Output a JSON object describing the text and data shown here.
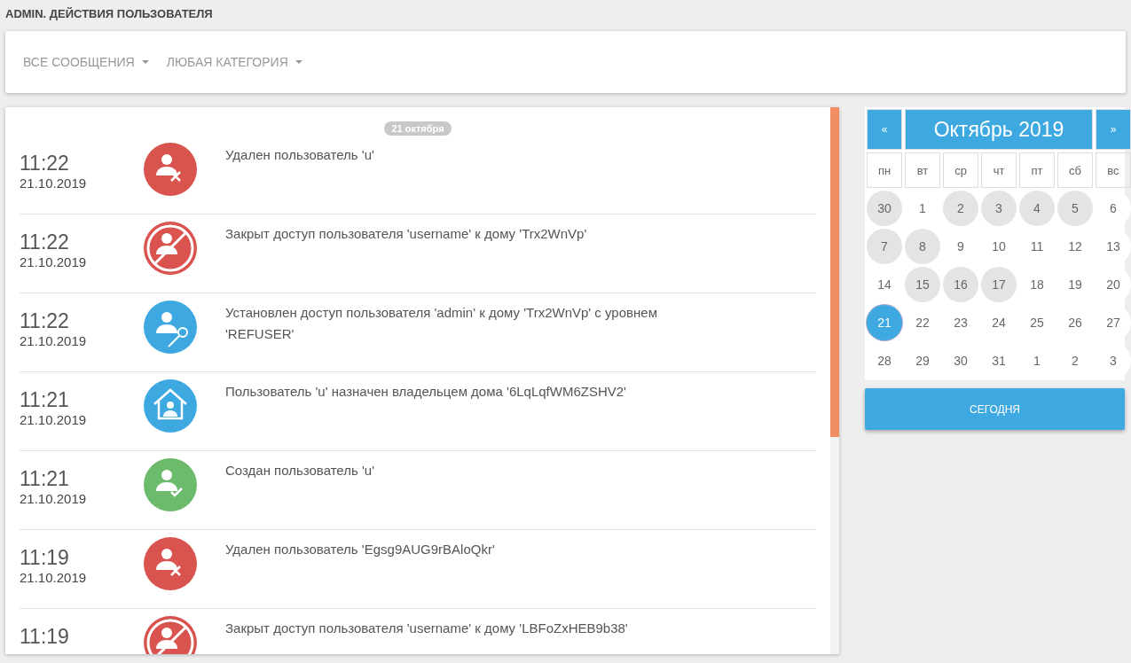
{
  "page_title": "ADMIN. ДЕЙСТВИЯ ПОЛЬЗОВАТЕЛЯ",
  "filters": [
    {
      "label": "ВСЕ СООБЩЕНИЯ"
    },
    {
      "label": "ЛЮБАЯ КАТЕГОРИЯ"
    }
  ],
  "feed": {
    "date_badge": "21 октября",
    "events": [
      {
        "time": "11:22",
        "date": "21.10.2019",
        "kind": "user-deleted",
        "text": "Удален пользователь 'u'"
      },
      {
        "time": "11:22",
        "date": "21.10.2019",
        "kind": "access-closed",
        "text": "Закрыт доступ пользователя 'username' к дому 'Trx2WnVp'"
      },
      {
        "time": "11:22",
        "date": "21.10.2019",
        "kind": "access-granted",
        "text": "Установлен доступ пользователя 'admin' к дому 'Trx2WnVp' с уровнем 'REFUSER'"
      },
      {
        "time": "11:21",
        "date": "21.10.2019",
        "kind": "owner-assigned",
        "text": "Пользователь 'u' назначен владельцем дома '6LqLqfWM6ZSHV2'"
      },
      {
        "time": "11:21",
        "date": "21.10.2019",
        "kind": "user-created",
        "text": "Создан пользователь 'u'"
      },
      {
        "time": "11:19",
        "date": "21.10.2019",
        "kind": "user-deleted",
        "text": "Удален пользователь 'Egsg9AUG9rBAloQkr'"
      },
      {
        "time": "11:19",
        "kind": "access-closed",
        "text": "Закрыт доступ пользователя 'username' к дому 'LBFoZxHEB9b38'"
      }
    ]
  },
  "calendar": {
    "prev": "«",
    "title": "Октябрь 2019",
    "next": "»",
    "weekdays": [
      "пн",
      "вт",
      "ср",
      "чт",
      "пт",
      "сб",
      "вс"
    ],
    "days": [
      {
        "day": "30",
        "has_events": true,
        "selected": false
      },
      {
        "day": "1",
        "has_events": false,
        "selected": false
      },
      {
        "day": "2",
        "has_events": true,
        "selected": false
      },
      {
        "day": "3",
        "has_events": true,
        "selected": false
      },
      {
        "day": "4",
        "has_events": true,
        "selected": false
      },
      {
        "day": "5",
        "has_events": true,
        "selected": false
      },
      {
        "day": "6",
        "has_events": false,
        "selected": false
      },
      {
        "day": "7",
        "has_events": true,
        "selected": false
      },
      {
        "day": "8",
        "has_events": true,
        "selected": false
      },
      {
        "day": "9",
        "has_events": false,
        "selected": false
      },
      {
        "day": "10",
        "has_events": false,
        "selected": false
      },
      {
        "day": "11",
        "has_events": false,
        "selected": false
      },
      {
        "day": "12",
        "has_events": false,
        "selected": false
      },
      {
        "day": "13",
        "has_events": false,
        "selected": false
      },
      {
        "day": "14",
        "has_events": false,
        "selected": false
      },
      {
        "day": "15",
        "has_events": true,
        "selected": false
      },
      {
        "day": "16",
        "has_events": true,
        "selected": false
      },
      {
        "day": "17",
        "has_events": true,
        "selected": false
      },
      {
        "day": "18",
        "has_events": false,
        "selected": false
      },
      {
        "day": "19",
        "has_events": false,
        "selected": false
      },
      {
        "day": "20",
        "has_events": false,
        "selected": false
      },
      {
        "day": "21",
        "has_events": true,
        "selected": true
      },
      {
        "day": "22",
        "has_events": false,
        "selected": false
      },
      {
        "day": "23",
        "has_events": false,
        "selected": false
      },
      {
        "day": "24",
        "has_events": false,
        "selected": false
      },
      {
        "day": "25",
        "has_events": false,
        "selected": false
      },
      {
        "day": "26",
        "has_events": false,
        "selected": false
      },
      {
        "day": "27",
        "has_events": false,
        "selected": false
      },
      {
        "day": "28",
        "has_events": false,
        "selected": false
      },
      {
        "day": "29",
        "has_events": false,
        "selected": false
      },
      {
        "day": "30",
        "has_events": false,
        "selected": false
      },
      {
        "day": "31",
        "has_events": false,
        "selected": false
      },
      {
        "day": "1",
        "has_events": false,
        "selected": false
      },
      {
        "day": "2",
        "has_events": false,
        "selected": false
      },
      {
        "day": "3",
        "has_events": false,
        "selected": false
      }
    ]
  },
  "today_button": "СЕГОДНЯ"
}
